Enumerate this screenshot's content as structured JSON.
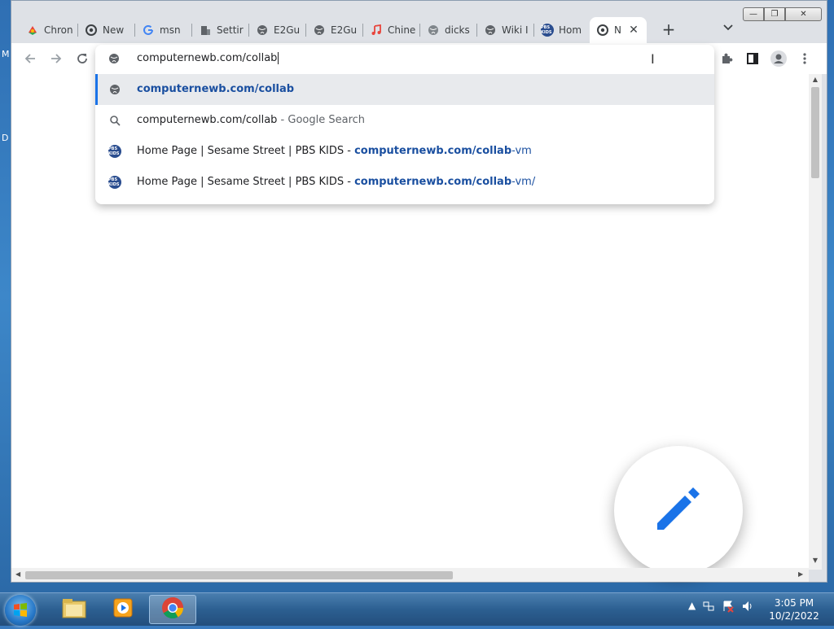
{
  "desktop": {
    "letters": [
      "M",
      "D"
    ]
  },
  "tabs": [
    {
      "label": "Chron",
      "icon": "chrome-logo-icon"
    },
    {
      "label": "New",
      "icon": "chrome-icon"
    },
    {
      "label": "msn",
      "icon": "google-icon"
    },
    {
      "label": "Settir",
      "icon": "building-icon"
    },
    {
      "label": "E2Gu",
      "icon": "globe-icon"
    },
    {
      "label": "E2Gu",
      "icon": "globe-icon"
    },
    {
      "label": "Chine",
      "icon": "music-note-icon"
    },
    {
      "label": "dicks",
      "icon": "globe-icon"
    },
    {
      "label": "Wiki I",
      "icon": "globe-icon"
    },
    {
      "label": "Hom",
      "icon": "pbs-kids-icon"
    },
    {
      "label": "N",
      "icon": "chrome-icon",
      "active": true
    }
  ],
  "toolbar": {
    "back": "back-icon",
    "forward": "forward-icon",
    "reload": "reload-icon"
  },
  "omnibox": {
    "input_text": "computernewb.com/collab",
    "suggestions": [
      {
        "type": "url",
        "bold": "computernewb.com/collab"
      },
      {
        "type": "search",
        "text": "computernewb.com/collab",
        "suffix": " - Google Search"
      },
      {
        "type": "history",
        "title": "Home Page | Sesame Street | PBS KIDS - ",
        "bold": "computernewb.com/collab",
        "rest": "-vm"
      },
      {
        "type": "history",
        "title": "Home Page | Sesame Street | PBS KIDS - ",
        "bold": "computernewb.com/collab",
        "rest": "-vm/"
      }
    ]
  },
  "pbs_logo_text": "PBS KIDS",
  "taskbar": {
    "clock_time": "3:05 PM",
    "clock_date": "10/2/2022"
  },
  "colors": {
    "accent": "#1a73e8",
    "link": "#1a4fa0",
    "fab_pencil": "#1a73e8"
  }
}
